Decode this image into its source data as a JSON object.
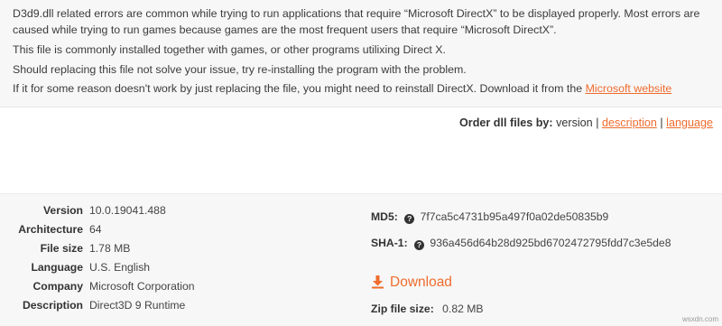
{
  "description": {
    "para1": "D3d9.dll related errors are common while trying to run applications that require “Microsoft DirectX” to be displayed properly. Most errors are caused while trying to run games because games are the most frequent users that require “Microsoft DirectX”.",
    "para2": "This file is commonly installed together with games, or other programs utilixing Direct X.",
    "para3": "Should replacing this file not solve your issue, try re-installing the program with the problem.",
    "para4_text": "If it for some reason doesn't work by just replacing the file, you might need to reinstall DirectX. Download it from the",
    "para4_link": "Microsoft website"
  },
  "order": {
    "label": "Order dll files by:",
    "current": "version",
    "separator": "|",
    "option_description": "description",
    "option_language": "language"
  },
  "file_info": [
    {
      "label": "Version",
      "value": "10.0.19041.488"
    },
    {
      "label": "Architecture",
      "value": "64"
    },
    {
      "label": "File size",
      "value": "1.78 MB"
    },
    {
      "label": "Language",
      "value": "U.S. English"
    },
    {
      "label": "Company",
      "value": "Microsoft Corporation"
    },
    {
      "label": "Description",
      "value": "Direct3D 9 Runtime"
    }
  ],
  "hashes": {
    "md5_label": "MD5:",
    "md5_value": "7f7ca5c4731b95a497f0a02de50835b9",
    "sha1_label": "SHA-1:",
    "sha1_value": "936a456d64b28d925bd6702472795fdd7c3e5de8",
    "help_glyph": "?"
  },
  "download": {
    "label": "Download",
    "zip_label": "Zip file size:",
    "zip_value": "0.82 MB"
  },
  "watermark": "wsxdn.com",
  "colors": {
    "accent": "#ef6c2e",
    "panel_bg": "#f7f7f7",
    "text": "#333333"
  }
}
